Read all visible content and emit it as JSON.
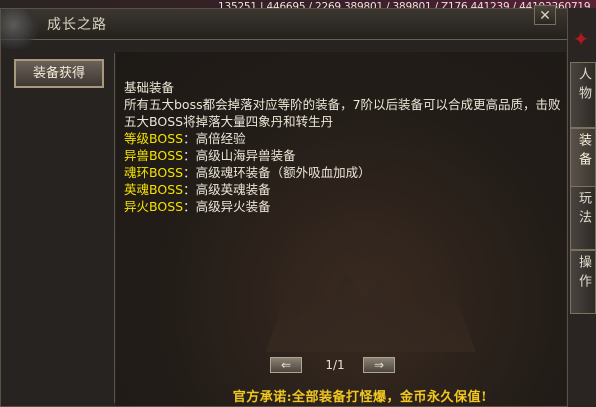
{
  "status_bar": {
    "stats": "135251 | 446695 / 2269 389801 / 389801 / Z176 441239 / 44193360719"
  },
  "window": {
    "title": "成长之路",
    "close_label": "✕"
  },
  "sidebar": {
    "active_tab": "装备获得"
  },
  "content": {
    "heading": "基础装备",
    "paragraph": "所有五大boss都会掉落对应等阶的装备，7阶以后装备可以合成更高品质，击败五大BOSS将掉落大量四象丹和转生丹",
    "rows": [
      {
        "name": "等级BOSS",
        "sep": "：",
        "desc": "高倍经验"
      },
      {
        "name": "异兽BOSS",
        "sep": "：",
        "desc": "高级山海异兽装备"
      },
      {
        "name": "魂环BOSS",
        "sep": "：",
        "desc": "高级魂环装备（额外吸血加成）"
      },
      {
        "name": "英魂BOSS",
        "sep": "：",
        "desc": "高级英魂装备"
      },
      {
        "name": "异火BOSS",
        "sep": "：",
        "desc": "高级异火装备"
      }
    ]
  },
  "pagination": {
    "prev_label": "⇐",
    "page": "1/1",
    "next_label": "⇒"
  },
  "footer": {
    "slogan": "官方承诺:全部装备打怪爆，金币永久保值!"
  },
  "right_tabs": [
    {
      "label": "人物"
    },
    {
      "label": "装备"
    },
    {
      "label": "玩法"
    },
    {
      "label": "操作"
    }
  ],
  "colors": {
    "highlight_yellow": "#f5e300",
    "slogan_gold": "#f0c820",
    "text_white": "#ece6d8"
  }
}
